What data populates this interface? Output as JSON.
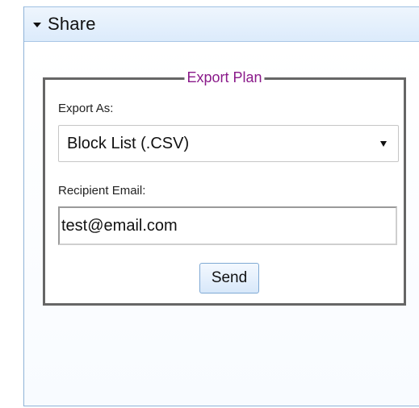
{
  "panel": {
    "title": "Share",
    "collapse_icon": "triangle-down-icon"
  },
  "export_plan": {
    "legend": "Export Plan",
    "export_as_label": "Export As:",
    "export_as_value": "Block List (.CSV)",
    "select_arrow_icon": "triangle-down-icon",
    "recipient_label": "Recipient Email:",
    "recipient_value": "test@email.com",
    "send_label": "Send"
  },
  "colors": {
    "legend": "#8a1a8a",
    "border": "#666666",
    "header_bg": "#dcebfb",
    "button_border": "#7fa9d4"
  }
}
